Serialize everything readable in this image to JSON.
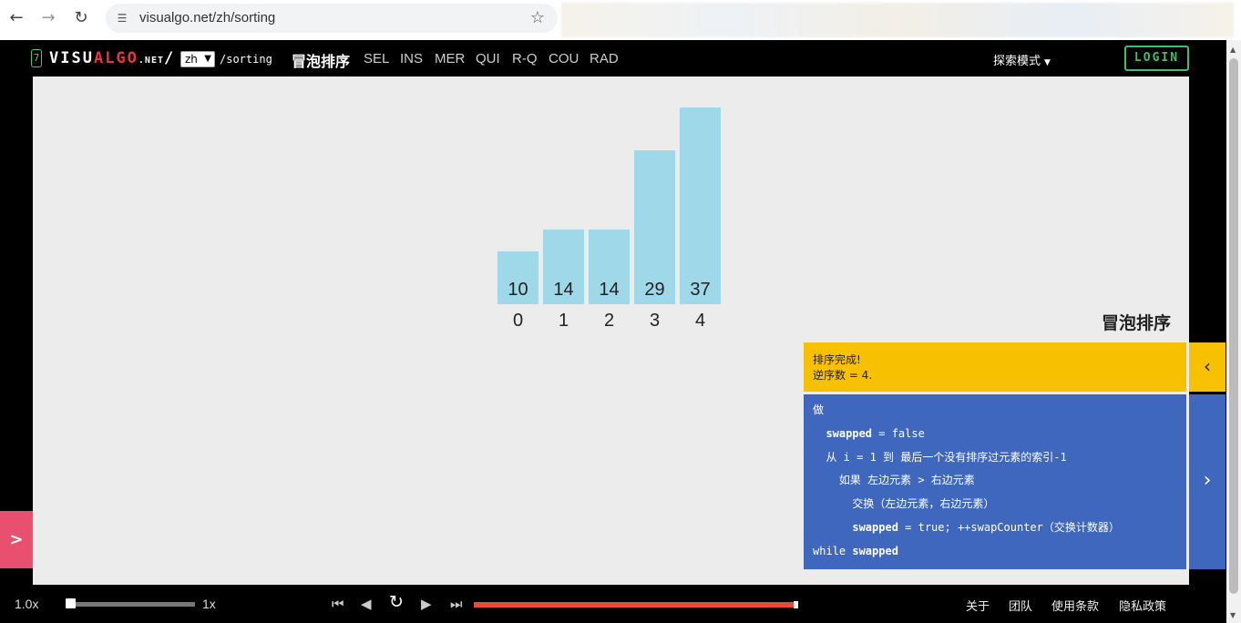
{
  "browser": {
    "url": "visualgo.net/zh/sorting"
  },
  "header": {
    "logo_seven": "7",
    "logo_visu": "VISU",
    "logo_algo": "ALGO",
    "logo_net": ".NET",
    "logo_slash": "/",
    "lang_value": "zh",
    "path": "/sorting",
    "active_algo": "冒泡排序",
    "algo_tabs": [
      "SEL",
      "INS",
      "MER",
      "QUI",
      "R-Q",
      "COU",
      "RAD"
    ],
    "mode_label": "探索模式",
    "login_label": "LOGIN"
  },
  "visualization": {
    "bars": [
      {
        "value": "10",
        "index": "0"
      },
      {
        "value": "14",
        "index": "1"
      },
      {
        "value": "14",
        "index": "2"
      },
      {
        "value": "29",
        "index": "3"
      },
      {
        "value": "37",
        "index": "4"
      }
    ],
    "bar_color": "#9fd8e8"
  },
  "panel": {
    "title": "冒泡排序",
    "status_line1": "排序完成!",
    "status_line2": "逆序数 = 4.",
    "status_color": "#f7c000",
    "code_color": "#3f67bd",
    "code": [
      {
        "pre": "做",
        "kw": "",
        "post": ""
      },
      {
        "pre": "  ",
        "kw": "swapped",
        "post": " = false"
      },
      {
        "pre": "  从 i = 1 到 最后一个没有排序过元素的索引-1",
        "kw": "",
        "post": ""
      },
      {
        "pre": "    如果 左边元素 > 右边元素",
        "kw": "",
        "post": ""
      },
      {
        "pre": "      交换（左边元素，右边元素）",
        "kw": "",
        "post": ""
      },
      {
        "pre": "      ",
        "kw": "swapped",
        "post": " = true; ++swapCounter（交换计数器）"
      },
      {
        "pre": "while ",
        "kw": "swapped",
        "post": ""
      }
    ]
  },
  "footer": {
    "speed_value": "1.0x",
    "speed_max": "1x",
    "speed_fraction": 0.0,
    "progress_fraction": 1.0,
    "links": [
      "关于",
      "团队",
      "使用条款",
      "隐私政策"
    ]
  },
  "icons": {
    "back": "back-arrow-icon",
    "forward": "forward-arrow-icon",
    "reload": "reload-icon",
    "bookmark": "star-icon",
    "collapse_status": "chevron-left-icon",
    "expand_code": "chevron-right-icon",
    "open_sidebar": "chevron-right-icon"
  }
}
